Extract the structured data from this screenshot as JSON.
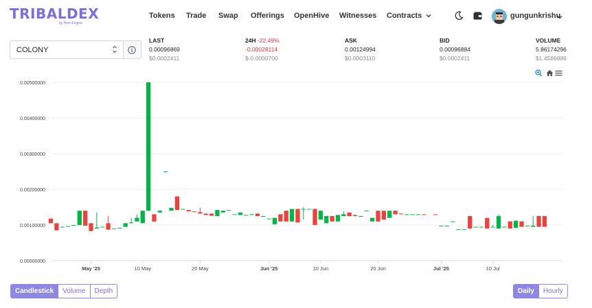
{
  "brand": {
    "name": "TRIBALDEX",
    "sub": "by Hive-Engine",
    "color": "#7b6fdc"
  },
  "nav": [
    {
      "label": "Tokens"
    },
    {
      "label": "Trade"
    },
    {
      "label": "Swap"
    },
    {
      "label": "Offerings"
    },
    {
      "label": "OpenHive"
    },
    {
      "label": "Witnesses"
    },
    {
      "label": "Contracts"
    }
  ],
  "header_icons": [
    "moon-icon",
    "wallet-icon"
  ],
  "user": {
    "name": "gungunkrishu"
  },
  "token_select": {
    "value": "COLONY"
  },
  "stats": [
    {
      "label": "LAST",
      "change": "",
      "value": "0.00096869",
      "usd": "$0.0002411"
    },
    {
      "label": "24H",
      "change": "-22.49%",
      "value": "-0.00028114",
      "usd": "$-0.0000700"
    },
    {
      "label": "ASK",
      "change": "",
      "value": "0.00124994",
      "usd": "$0.0003110"
    },
    {
      "label": "BID",
      "change": "",
      "value": "0.00096884",
      "usd": "$0.0002411"
    },
    {
      "label": "VOLUME",
      "change": "",
      "value": "5.86174296",
      "usd": "$1.4586889"
    }
  ],
  "chart_toolbar": [
    "zoom-in-icon",
    "home-icon",
    "menu-icon"
  ],
  "colors": {
    "up": "#00b746",
    "down": "#ef403c",
    "accent": "#8f87e6"
  },
  "chart_data": {
    "type": "candlestick",
    "ylim": [
      0,
      0.005
    ],
    "y_ticks": [
      "0.00500000",
      "0.00400000",
      "0.00300000",
      "0.00200000",
      "0.00100000",
      "0.00000000"
    ],
    "x_range": [
      "2025-04-24",
      "2025-07-22"
    ],
    "x_ticks": [
      {
        "date": "2025-05-01",
        "label": "May '25",
        "bold": true
      },
      {
        "date": "2025-05-10",
        "label": "10 May",
        "bold": false
      },
      {
        "date": "2025-05-20",
        "label": "20 May",
        "bold": false
      },
      {
        "date": "2025-06-01",
        "label": "Jun '25",
        "bold": true
      },
      {
        "date": "2025-06-10",
        "label": "10 Jun",
        "bold": false
      },
      {
        "date": "2025-06-20",
        "label": "20 Jun",
        "bold": false
      },
      {
        "date": "2025-07-01",
        "label": "Jul '25",
        "bold": true
      },
      {
        "date": "2025-07-10",
        "label": "10 Jul",
        "bold": false
      }
    ],
    "candles": [
      {
        "date": "2025-04-24",
        "o": 0.00118,
        "h": 0.00118,
        "l": 0.00105,
        "c": 0.00105
      },
      {
        "date": "2025-04-25",
        "o": 0.00105,
        "h": 0.00105,
        "l": 0.00085,
        "c": 0.00085
      },
      {
        "date": "2025-04-26",
        "o": 0.00095,
        "h": 0.00095,
        "l": 0.00095,
        "c": 0.00095
      },
      {
        "date": "2025-04-27",
        "o": 0.00097,
        "h": 0.00097,
        "l": 0.00097,
        "c": 0.00097
      },
      {
        "date": "2025-04-28",
        "o": 0.001,
        "h": 0.001,
        "l": 0.001,
        "c": 0.001
      },
      {
        "date": "2025-04-29",
        "o": 0.001,
        "h": 0.0014,
        "l": 0.001,
        "c": 0.0014
      },
      {
        "date": "2025-04-30",
        "o": 0.0014,
        "h": 0.0014,
        "l": 0.00098,
        "c": 0.00098
      },
      {
        "date": "2025-05-01",
        "o": 0.00105,
        "h": 0.00105,
        "l": 0.00083,
        "c": 0.00083
      },
      {
        "date": "2025-05-02",
        "o": 0.0009,
        "h": 0.00135,
        "l": 0.0009,
        "c": 0.00093
      },
      {
        "date": "2025-05-03",
        "o": 0.00095,
        "h": 0.00095,
        "l": 0.00095,
        "c": 0.00095
      },
      {
        "date": "2025-05-04",
        "o": 0.00105,
        "h": 0.00125,
        "l": 0.00087,
        "c": 0.00087
      },
      {
        "date": "2025-05-05",
        "o": 0.0009,
        "h": 0.0009,
        "l": 0.0009,
        "c": 0.0009
      },
      {
        "date": "2025-05-06",
        "o": 0.00092,
        "h": 0.00092,
        "l": 0.00092,
        "c": 0.00092
      },
      {
        "date": "2025-05-07",
        "o": 0.00095,
        "h": 0.00105,
        "l": 0.00095,
        "c": 0.00105
      },
      {
        "date": "2025-05-08",
        "o": 0.00105,
        "h": 0.0012,
        "l": 0.00105,
        "c": 0.00107
      },
      {
        "date": "2025-05-09",
        "o": 0.0011,
        "h": 0.0013,
        "l": 0.0011,
        "c": 0.0012
      },
      {
        "date": "2025-05-10",
        "o": 0.00105,
        "h": 0.0014,
        "l": 0.00105,
        "c": 0.0014
      },
      {
        "date": "2025-05-11",
        "o": 0.0014,
        "h": 0.005,
        "l": 0.0014,
        "c": 0.005
      },
      {
        "date": "2025-05-12",
        "o": 0.0013,
        "h": 0.0013,
        "l": 0.0011,
        "c": 0.0011
      },
      {
        "date": "2025-05-13",
        "o": 0.00135,
        "h": 0.0014,
        "l": 0.00135,
        "c": 0.0014
      },
      {
        "date": "2025-05-14",
        "o": 0.0025,
        "h": 0.0025,
        "l": 0.0025,
        "c": 0.0025
      },
      {
        "date": "2025-05-15",
        "o": 0.0014,
        "h": 0.00148,
        "l": 0.0014,
        "c": 0.00148
      },
      {
        "date": "2025-05-16",
        "o": 0.0018,
        "h": 0.0018,
        "l": 0.00142,
        "c": 0.00142
      },
      {
        "date": "2025-05-17",
        "o": 0.00145,
        "h": 0.00145,
        "l": 0.00145,
        "c": 0.00145
      },
      {
        "date": "2025-05-18",
        "o": 0.00142,
        "h": 0.00142,
        "l": 0.00138,
        "c": 0.00138
      },
      {
        "date": "2025-05-19",
        "o": 0.00138,
        "h": 0.00138,
        "l": 0.00136,
        "c": 0.00136
      },
      {
        "date": "2025-05-20",
        "o": 0.00136,
        "h": 0.00148,
        "l": 0.00132,
        "c": 0.00132
      },
      {
        "date": "2025-05-21",
        "o": 0.00132,
        "h": 0.00132,
        "l": 0.00128,
        "c": 0.00128
      },
      {
        "date": "2025-05-22",
        "o": 0.00132,
        "h": 0.00132,
        "l": 0.00126,
        "c": 0.00126
      },
      {
        "date": "2025-05-23",
        "o": 0.00125,
        "h": 0.00142,
        "l": 0.00125,
        "c": 0.00142
      },
      {
        "date": "2025-05-24",
        "o": 0.00135,
        "h": 0.0014,
        "l": 0.00135,
        "c": 0.0014
      },
      {
        "date": "2025-05-25",
        "o": 0.00142,
        "h": 0.00142,
        "l": 0.00142,
        "c": 0.00142
      },
      {
        "date": "2025-05-26",
        "o": 0.0013,
        "h": 0.0013,
        "l": 0.0013,
        "c": 0.0013
      },
      {
        "date": "2025-05-27",
        "o": 0.00128,
        "h": 0.00135,
        "l": 0.00128,
        "c": 0.00135
      },
      {
        "date": "2025-05-28",
        "o": 0.00128,
        "h": 0.00128,
        "l": 0.00128,
        "c": 0.00128
      },
      {
        "date": "2025-05-29",
        "o": 0.0013,
        "h": 0.00132,
        "l": 0.0013,
        "c": 0.0013
      },
      {
        "date": "2025-05-30",
        "o": 0.00132,
        "h": 0.00132,
        "l": 0.00125,
        "c": 0.00125
      },
      {
        "date": "2025-05-31",
        "o": 0.00125,
        "h": 0.00125,
        "l": 0.00125,
        "c": 0.00125
      },
      {
        "date": "2025-06-01",
        "o": 0.00118,
        "h": 0.00118,
        "l": 0.00118,
        "c": 0.00118
      },
      {
        "date": "2025-06-02",
        "o": 0.00102,
        "h": 0.0012,
        "l": 0.00102,
        "c": 0.0012
      },
      {
        "date": "2025-06-03",
        "o": 0.0013,
        "h": 0.0013,
        "l": 0.0011,
        "c": 0.0011
      },
      {
        "date": "2025-06-04",
        "o": 0.0014,
        "h": 0.0014,
        "l": 0.0011,
        "c": 0.0011
      },
      {
        "date": "2025-06-05",
        "o": 0.0011,
        "h": 0.00145,
        "l": 0.0011,
        "c": 0.00145
      },
      {
        "date": "2025-06-06",
        "o": 0.00145,
        "h": 0.00145,
        "l": 0.00107,
        "c": 0.00107
      },
      {
        "date": "2025-06-07",
        "o": 0.00145,
        "h": 0.0015,
        "l": 0.00115,
        "c": 0.00145
      },
      {
        "date": "2025-06-08",
        "o": 0.00145,
        "h": 0.00145,
        "l": 0.00145,
        "c": 0.00145
      },
      {
        "date": "2025-06-09",
        "o": 0.00145,
        "h": 0.00145,
        "l": 0.001,
        "c": 0.001
      },
      {
        "date": "2025-06-10",
        "o": 0.00115,
        "h": 0.0014,
        "l": 0.00115,
        "c": 0.0014
      },
      {
        "date": "2025-06-11",
        "o": 0.00105,
        "h": 0.00125,
        "l": 0.00105,
        "c": 0.00125
      },
      {
        "date": "2025-06-12",
        "o": 0.00125,
        "h": 0.00125,
        "l": 0.0011,
        "c": 0.0011
      },
      {
        "date": "2025-06-13",
        "o": 0.0011,
        "h": 0.00128,
        "l": 0.0011,
        "c": 0.00128
      },
      {
        "date": "2025-06-14",
        "o": 0.00125,
        "h": 0.00138,
        "l": 0.00125,
        "c": 0.0013
      },
      {
        "date": "2025-06-15",
        "o": 0.00135,
        "h": 0.00135,
        "l": 0.00125,
        "c": 0.00125
      },
      {
        "date": "2025-06-16",
        "o": 0.00128,
        "h": 0.00128,
        "l": 0.00125,
        "c": 0.00125
      },
      {
        "date": "2025-06-17",
        "o": 0.00125,
        "h": 0.00125,
        "l": 0.00125,
        "c": 0.00125
      },
      {
        "date": "2025-06-18",
        "o": 0.0014,
        "h": 0.0014,
        "l": 0.0014,
        "c": 0.0014
      },
      {
        "date": "2025-06-19",
        "o": 0.0011,
        "h": 0.0012,
        "l": 0.0011,
        "c": 0.0012
      },
      {
        "date": "2025-06-20",
        "o": 0.0014,
        "h": 0.0014,
        "l": 0.0011,
        "c": 0.0011
      },
      {
        "date": "2025-06-21",
        "o": 0.0014,
        "h": 0.0014,
        "l": 0.00115,
        "c": 0.00115
      },
      {
        "date": "2025-06-22",
        "o": 0.0012,
        "h": 0.0014,
        "l": 0.0012,
        "c": 0.0014
      },
      {
        "date": "2025-06-23",
        "o": 0.0014,
        "h": 0.0014,
        "l": 0.0013,
        "c": 0.0013
      },
      {
        "date": "2025-06-24",
        "o": 0.00132,
        "h": 0.00132,
        "l": 0.0013,
        "c": 0.0013
      },
      {
        "date": "2025-06-25",
        "o": 0.0013,
        "h": 0.0013,
        "l": 0.0013,
        "c": 0.0013
      },
      {
        "date": "2025-06-26",
        "o": 0.0013,
        "h": 0.0013,
        "l": 0.0013,
        "c": 0.0013
      },
      {
        "date": "2025-06-27",
        "o": 0.0013,
        "h": 0.0013,
        "l": 0.0013,
        "c": 0.0013
      },
      {
        "date": "2025-06-28",
        "o": 0.0013,
        "h": 0.0013,
        "l": 0.00128,
        "c": 0.00128
      },
      {
        "date": "2025-06-30",
        "o": 0.0013,
        "h": 0.0013,
        "l": 0.00128,
        "c": 0.00128
      },
      {
        "date": "2025-07-01",
        "o": 0.00098,
        "h": 0.00098,
        "l": 0.00098,
        "c": 0.00098
      },
      {
        "date": "2025-07-02",
        "o": 0.00098,
        "h": 0.00098,
        "l": 0.00098,
        "c": 0.00098
      },
      {
        "date": "2025-07-03",
        "o": 0.0011,
        "h": 0.0011,
        "l": 0.0011,
        "c": 0.0011
      },
      {
        "date": "2025-07-04",
        "o": 0.00088,
        "h": 0.00088,
        "l": 0.00088,
        "c": 0.00088
      },
      {
        "date": "2025-07-05",
        "o": 0.00088,
        "h": 0.00088,
        "l": 0.00088,
        "c": 0.00088
      },
      {
        "date": "2025-07-06",
        "o": 0.00125,
        "h": 0.00125,
        "l": 0.0009,
        "c": 0.0009
      },
      {
        "date": "2025-07-07",
        "o": 0.00095,
        "h": 0.00095,
        "l": 0.00095,
        "c": 0.00095
      },
      {
        "date": "2025-07-08",
        "o": 0.00095,
        "h": 0.00095,
        "l": 0.00095,
        "c": 0.00095
      },
      {
        "date": "2025-07-09",
        "o": 0.0012,
        "h": 0.0012,
        "l": 0.0009,
        "c": 0.0009
      },
      {
        "date": "2025-07-10",
        "o": 0.00095,
        "h": 0.001,
        "l": 0.00095,
        "c": 0.00095
      },
      {
        "date": "2025-07-11",
        "o": 0.0009,
        "h": 0.0013,
        "l": 0.0009,
        "c": 0.00125
      },
      {
        "date": "2025-07-12",
        "o": 0.00095,
        "h": 0.00095,
        "l": 0.00095,
        "c": 0.00095
      },
      {
        "date": "2025-07-13",
        "o": 0.0011,
        "h": 0.0011,
        "l": 0.0009,
        "c": 0.0009
      },
      {
        "date": "2025-07-14",
        "o": 0.00092,
        "h": 0.00112,
        "l": 0.00092,
        "c": 0.00112
      },
      {
        "date": "2025-07-15",
        "o": 0.0011,
        "h": 0.0011,
        "l": 0.00095,
        "c": 0.00095
      },
      {
        "date": "2025-07-16",
        "o": 0.00098,
        "h": 0.00098,
        "l": 0.00098,
        "c": 0.00098
      },
      {
        "date": "2025-07-17",
        "o": 0.00095,
        "h": 0.00125,
        "l": 0.00095,
        "c": 0.00098
      },
      {
        "date": "2025-07-18",
        "o": 0.00125,
        "h": 0.00125,
        "l": 0.00095,
        "c": 0.00095
      },
      {
        "date": "2025-07-19",
        "o": 0.00125,
        "h": 0.00125,
        "l": 0.00095,
        "c": 0.00095
      }
    ]
  },
  "view_buttons": [
    {
      "label": "Candlestick",
      "active": true
    },
    {
      "label": "Volume",
      "active": false
    },
    {
      "label": "Depth",
      "active": false
    }
  ],
  "interval_buttons": [
    {
      "label": "Daily",
      "active": true
    },
    {
      "label": "Hourly",
      "active": false
    }
  ]
}
